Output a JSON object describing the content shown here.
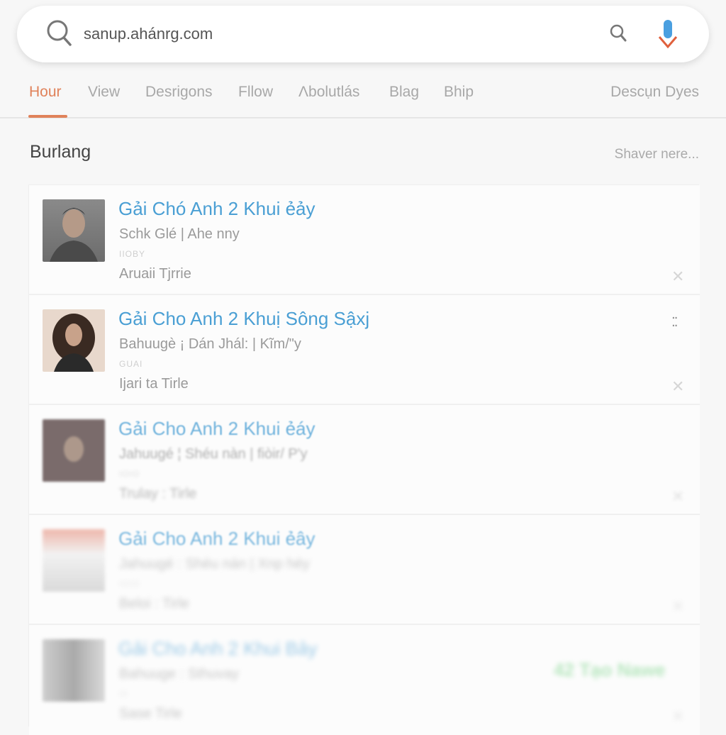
{
  "search": {
    "value": "sanup.ahánrg.com",
    "icons": [
      "search-icon",
      "mic-icon"
    ],
    "mic_colors": [
      "#4a9fe0",
      "#e0603c"
    ]
  },
  "tabs": [
    {
      "label": "Hour",
      "active": true
    },
    {
      "label": "View"
    },
    {
      "label": "Desrigons"
    },
    {
      "label": "Fllow"
    },
    {
      "label": "Λbolutlás"
    },
    {
      "label": "Blag"
    },
    {
      "label": "Bhip"
    }
  ],
  "tab_right": "Descụn Dyes",
  "section": {
    "title": "Burlang",
    "link": "Shaver nere..."
  },
  "accent": "#e0825a",
  "title_color": "#4a9fd4",
  "items": [
    {
      "title": "Gải Chó Anh 2 Khui ẻảy",
      "sub": "Schk Glé | Ahe nny",
      "meta": "IIOBY",
      "line": "Aruaii Tjrrie"
    },
    {
      "title": "Gải Cho Anh 2 Khuị Sông Sậxj",
      "sub": "Bahuugè ¡ Dán Jhál: | Kĩm/\"y",
      "meta": "GUAI",
      "line": "Ijari ta Tirle"
    },
    {
      "title": "Gải Cho Anh 2 Khui ẻáy",
      "sub": "Jahuugé ¦ Shéu nàn | fiòir/ P'y",
      "meta": "IOIO",
      "line": "Trulay : Tirle"
    },
    {
      "title": "Gải Cho Anh 2 Khui ẻây",
      "sub": "Jahuugé : Shéu nán | Xnp héy",
      "meta": "IOIO",
      "line": "Beloi : Tirle"
    },
    {
      "title": "Gải Cho Anh 2 Khui Bảy",
      "sub": "Bahuuge : Sthuvay",
      "meta": "III",
      "line": "Sase Tirle",
      "badge": "42 Tạo Nawe"
    }
  ]
}
